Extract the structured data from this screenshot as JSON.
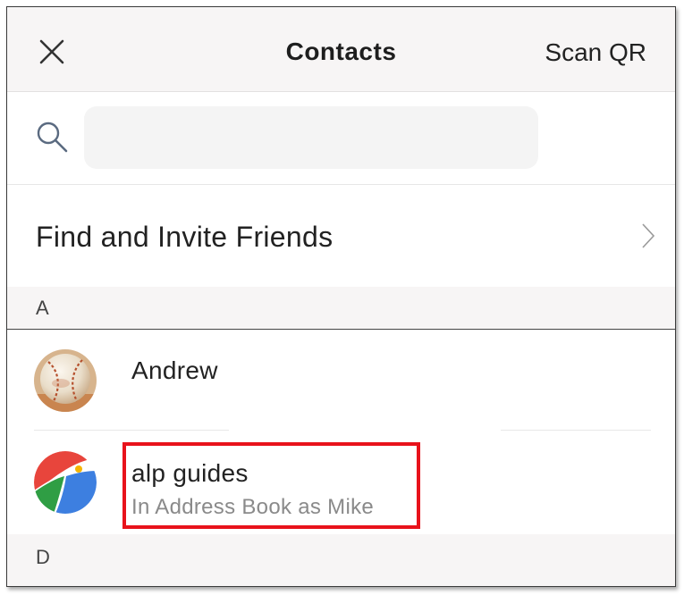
{
  "header": {
    "title": "Contacts",
    "scan_qr_label": "Scan QR",
    "close_icon": "close-icon"
  },
  "search": {
    "icon": "search-icon",
    "value": "",
    "placeholder": ""
  },
  "invite": {
    "label": "Find and Invite Friends",
    "icon": "chevron-right-icon"
  },
  "sections": [
    {
      "letter": "A",
      "contacts": [
        {
          "name": "Andrew",
          "subtitle": "",
          "avatar": "baseball-avatar"
        },
        {
          "name": "alp guides",
          "subtitle": "In Address Book as Mike",
          "avatar": "alp-guides-logo-avatar",
          "highlighted": true
        }
      ]
    },
    {
      "letter": "D",
      "contacts": []
    }
  ],
  "colors": {
    "header_bg": "#f7f5f5",
    "section_bg": "#f7f5f5",
    "search_field_bg": "#f4f4f4",
    "highlight": "#e8121b",
    "subtitle": "#8a8a8a"
  }
}
